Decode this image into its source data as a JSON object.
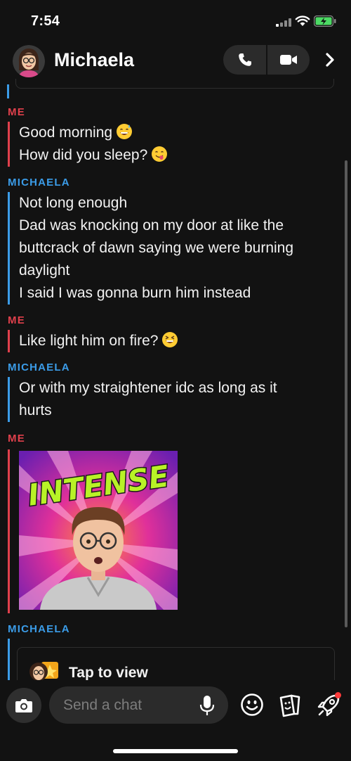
{
  "status_bar": {
    "time": "7:54"
  },
  "header": {
    "contact_name": "Michaela",
    "icons": {
      "phone": "phone-icon",
      "video": "video-camera-icon",
      "more": "chevron-right-icon"
    }
  },
  "messages": [
    {
      "sender": "ME",
      "lines": [
        "Good morning",
        "How did you sleep?"
      ],
      "emojis": [
        "grinning-sweat-emoji",
        "yum-emoji"
      ]
    },
    {
      "sender": "MICHAELA",
      "lines": [
        "Not long enough",
        "Dad was knocking on my door at like the",
        "buttcrack of dawn saying we were burning",
        "daylight",
        "I said I was gonna burn him instead"
      ]
    },
    {
      "sender": "ME",
      "lines": [
        "Like light him on fire?"
      ],
      "emojis": [
        "laughing-squint-emoji"
      ]
    },
    {
      "sender": "MICHAELA",
      "lines": [
        "Or with my straightener idc as long as it",
        "hurts"
      ]
    },
    {
      "sender": "ME",
      "sticker_text": "INTENSE"
    },
    {
      "sender": "MICHAELA",
      "snap_label": "Tap to view"
    }
  ],
  "composer": {
    "placeholder": "Send a chat",
    "icons": {
      "camera": "camera-icon",
      "mic": "microphone-icon",
      "smiley": "smiley-icon",
      "sticker": "sticker-icon",
      "games": "rocket-icon"
    }
  },
  "colors": {
    "me": "#e0404c",
    "friend": "#3b9ce8",
    "background": "#121212"
  }
}
